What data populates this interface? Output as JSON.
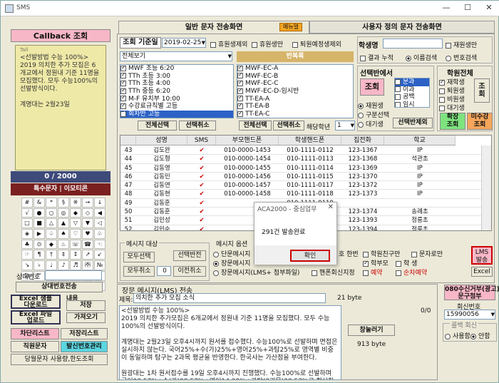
{
  "window": {
    "title": "SMS",
    "min": "—",
    "max": "☐",
    "close": "✕"
  },
  "left": {
    "callback_title": "Callback 조회",
    "signal": "Tall",
    "preview_text": "<선발방법 수능 100%>\n2019 의치한 추가 모집은 6개교에서 정원내 기준 11명을 모집했다. 모두 수능100%의 선발방식이다.\n\n계명대는 2월23일",
    "counter": "0 / 2000",
    "special_link": "특수문자 | 이모티콘",
    "symbols": [
      "#",
      "&",
      "*",
      "§",
      "※",
      "→",
      "↓",
      "√",
      "●",
      "○",
      "◎",
      "◆",
      "◇",
      "◀",
      "□",
      "■",
      "△",
      "▲",
      "▽",
      "▼",
      "◁",
      "◈",
      "▶",
      "♤",
      "♠",
      "♡",
      "♥",
      "♧",
      "♣",
      "⊙",
      "◆",
      "♨",
      "☏",
      "☎",
      "☜",
      "☞",
      "¶",
      "†",
      "‡",
      "↕",
      "↗",
      "↙",
      "↘",
      "♭",
      "♩",
      "♪",
      "♬",
      "㈜",
      "№",
      "㏇",
      "™",
      "㏂",
      "㏘",
      "℡",
      "▣",
      "◐",
      "◑",
      "▒",
      "▤",
      "▥",
      "▨",
      "▧",
      "▦"
    ],
    "counterpart_label": "상대번호",
    "counterpart_btn": "상대번호전송",
    "excel_sample_btn": "Excel 샘플\n다운로드",
    "content_label": "내용",
    "save_btn": "저장",
    "excel_upload_btn": "Excel 파일\n업로드",
    "load_btn": "가져오기",
    "block_list_btn": "차단리스트",
    "save_list_btn": "저장리스트",
    "staff_sms_btn": "직원문자",
    "sender_mgmt_btn": "발신번호관리",
    "usage_btn": "당월문자 사용량,한도조회"
  },
  "tabs": {
    "general": "일반 문자 전송화면",
    "menu_badge": "메뉴얼",
    "user_defined": "사용자 정의 문자 전송화면"
  },
  "query": {
    "date_label": "조회 기준일",
    "date_value": "2019-02-25",
    "excl_leave": "휴원생제외",
    "leave_student": "휴원생만",
    "expected_leave": "퇴원예정생제외",
    "view_all": "전체보기",
    "repeat_label": "반복록"
  },
  "class_list_left": [
    "MWF 초등 6:20",
    "TTh 초등 3:00",
    "TTh 초등 4:00",
    "TTh 중등 6:20",
    "M-F 유치부 10:00",
    "수강료규칙별 고등",
    "회차반 고등"
  ],
  "class_list_right": [
    "MWF-EC-A",
    "MWF-EC-B",
    "MWF-EC-C",
    "MWF-EC-D-임시반",
    "TT-EA-A",
    "TT-EA-B",
    "TT-EA-C"
  ],
  "class_buttons": {
    "select_all_l": "전체선택",
    "deselect_l": "선택취소",
    "select_all_r": "전체선택",
    "deselect_r": "선택취소",
    "grade_label": "해당학년",
    "grade_value": "1"
  },
  "student_search": {
    "name_label": "학생명",
    "attending_only": "재원생만",
    "accumulate": "결과 누적",
    "name_search": "이름검색",
    "phone_search": "번호검색"
  },
  "class_select": {
    "title": "선택반에서",
    "query_btn": "조회",
    "opt_attending": "재원생",
    "opt_split": "구분선택",
    "opt_waiting": "대기생",
    "subjects": [
      "문과",
      "이과",
      "공백",
      "임시"
    ],
    "apply_btn": "선택반제외"
  },
  "academy_all": {
    "title": "학원전체",
    "options": [
      "재학생",
      "퇴원생",
      "비원생",
      "대기생"
    ],
    "query_btn": "조\n회",
    "expand_btn": "확장\n조회",
    "unpaid_btn": "미수강\n조회"
  },
  "table": {
    "headers": [
      "",
      "성명",
      "SMS",
      "부모핸드폰",
      "학생핸드폰",
      "집전화",
      "학교"
    ],
    "rows": [
      [
        "43",
        "김도완",
        "✔",
        "010-0000-1453",
        "010-1111-0112",
        "123-1367",
        "IP"
      ],
      [
        "44",
        "김도형",
        "✔",
        "010-0000-1454",
        "010-1111-0113",
        "123-1368",
        "석관초"
      ],
      [
        "45",
        "김동영",
        "✔",
        "010-0000-1455",
        "010-1111-0114",
        "123-1369",
        "IP"
      ],
      [
        "46",
        "김동민",
        "✔",
        "010-0000-1456",
        "010-1111-0115",
        "123-1370",
        "IP"
      ],
      [
        "47",
        "김동연",
        "✔",
        "010-0000-1457",
        "010-1111-0117",
        "123-1372",
        "IP"
      ],
      [
        "48",
        "김동현",
        "✔",
        "010-0000-1458",
        "010-1111-0118",
        "123-1373",
        "IP"
      ],
      [
        "49",
        "김동훈",
        "✔",
        "",
        "010-1111-0119",
        "",
        ""
      ],
      [
        "50",
        "김동훈",
        "✔",
        "",
        "010-1111-0120",
        "123-1374",
        "송례초"
      ],
      [
        "51",
        "김민성",
        "✔",
        "",
        "010-1111-0131",
        "123-1393",
        "정릉초"
      ],
      [
        "52",
        "김민순",
        "✔",
        "",
        "010-1111-0132",
        "123-1394",
        "정릉초"
      ]
    ]
  },
  "message_target": {
    "title": "메시지 대상",
    "select_all": "모두선택",
    "invert": "선택반전",
    "clear_all": "모두취소",
    "count": "0",
    "prev_cancel": "이전취소"
  },
  "message_options": {
    "title": "메시지 옵션",
    "short": "단문메시지",
    "long": "장문메시지",
    "long_attach": "장문메시지(LMS+ 첨부파일)",
    "handphone_only": "핸폰회신지정",
    "once_per_number": "호 한번",
    "academy_family": "학원친구만",
    "sms_only": "문자로만",
    "parents": "학부모",
    "student": "학 생",
    "reserve": "예약",
    "sequential": "순차예약",
    "lms_btn": "LMS\n발송",
    "excel_btn": "Excel"
  },
  "dialog": {
    "title": "ACA2000 - 중심업무",
    "message": "291건 발송완료",
    "ok": "확인"
  },
  "lms": {
    "title": "장문 메시지(LMS) 전송",
    "subject_label": "제목:",
    "subject_value": "의치한 추가 모집 소식",
    "subject_bytes": "21 byte",
    "body": "<선발방법 수능 100%>\n2019 의치한 추가모집은 6개교에서 정원내 기준 11명을 모집했다. 모두 수능100%의 선발방식이다.\n\n계명대는 2월23일 오후4시까지 원서를 접수했다. 수능100%로 선발하며 면접은 실시하지 않는다. 국어25%+수(가)25%+영어25%+과탐25%로 영역별 비중이 동일하며 탐구는 2과목 평균을 반영한다. 한국사는 가산점을 부여한다.\n\n원광대는 1차 원서접수를 19일 오후4시까지 진행했다. 수능100%로 선발하며 국어28.57%+수(가)28.57%+영어14.29%+과탐(2과목)28.57%로 합산한다.",
    "page": "0/0",
    "recall_btn": "창눌러기",
    "body_bytes": "913 byte"
  },
  "right_bottom": {
    "reply_title": "080수신거부(광고)\n문구첨부",
    "reply_number_label": "회신번호",
    "reply_number_value": "15990056",
    "recall_label": "콜백 회신",
    "use": "사용함",
    "no_use": "안함"
  }
}
